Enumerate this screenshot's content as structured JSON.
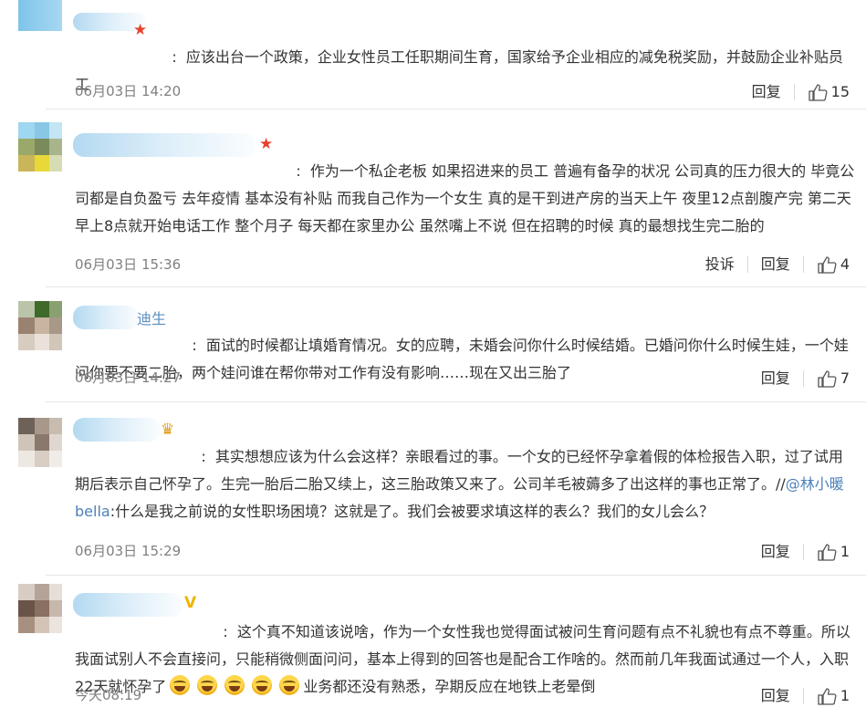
{
  "comments": [
    {
      "name_fragment": "",
      "badge": "★",
      "badge_color": "#e8412c",
      "text": "应该出台一个政策，企业女性员工任职期间生育，国家给予企业相应的减免税奖励，并鼓励企业补贴员工",
      "time": "06月03日 14:20",
      "report_label": "",
      "reply_label": "回复",
      "likes": "15"
    },
    {
      "name_fragment": "",
      "badge": "★",
      "badge_color": "#e8412c",
      "text": "作为一个私企老板 如果招进来的员工 普遍有备孕的状况 公司真的压力很大的 毕竟公司都是自负盈亏 去年疫情 基本没有补贴 而我自己作为一个女生 真的是干到进产房的当天上午 夜里12点剖腹产完 第二天早上8点就开始电话工作 整个月子 每天都在家里办公 虽然嘴上不说 但在招聘的时候 真的最想找生完二胎的",
      "time": "06月03日 15:36",
      "report_label": "投诉",
      "reply_label": "回复",
      "likes": "4"
    },
    {
      "name_fragment": "迪生",
      "badge": "",
      "badge_color": "",
      "text": "面试的时候都让填婚育情况。女的应聘，未婚会问你什么时候结婚。已婚问你什么时候生娃，一个娃问你要不要二胎，两个娃问谁在帮你带对工作有没有影响……现在又出三胎了",
      "time": "06月03日 14:27",
      "report_label": "",
      "reply_label": "回复",
      "likes": "7"
    },
    {
      "name_fragment": "",
      "badge": "♛",
      "badge_color": "#e0a020",
      "text_before": "其实想想应该为什么会这样？亲眼看过的事。一个女的已经怀孕拿着假的体检报告入职，过了试用期后表示自己怀孕了。生完一胎后二胎又续上，这三胎政策又来了。公司羊毛被薅多了出这样的事也正常了。//",
      "mention": "@林小暖bella",
      "text_after": ":什么是我之前说的女性职场困境？这就是了。我们会被要求填这样的表么？我们的女儿会么？",
      "time": "06月03日 15:29",
      "report_label": "",
      "reply_label": "回复",
      "likes": "1"
    },
    {
      "name_fragment": "",
      "badge": "V",
      "badge_color": "#f0b400",
      "text_before": "这个真不知道该说啥，作为一个女性我也觉得面试被问生育问题有点不礼貌也有点不尊重。所以我面试别人不会直接问，只能稍微侧面问问，基本上得到的回答也是配合工作啥的。然而前几年我面试通过一个人，入职22天就怀孕了",
      "emoji_name": "laughing-tears-emoji",
      "emoji_count_text": "5",
      "text_after": "业务都还没有熟悉，孕期反应在地铁上老晕倒",
      "time": "今天08:19",
      "report_label": "",
      "reply_label": "回复",
      "likes": "1"
    }
  ],
  "colors": {
    "text": "#333333",
    "meta": "#808080",
    "link": "#5b8fbf",
    "divider": "#e6e6e6"
  },
  "icons": {
    "like": "thumbs-up-icon"
  }
}
